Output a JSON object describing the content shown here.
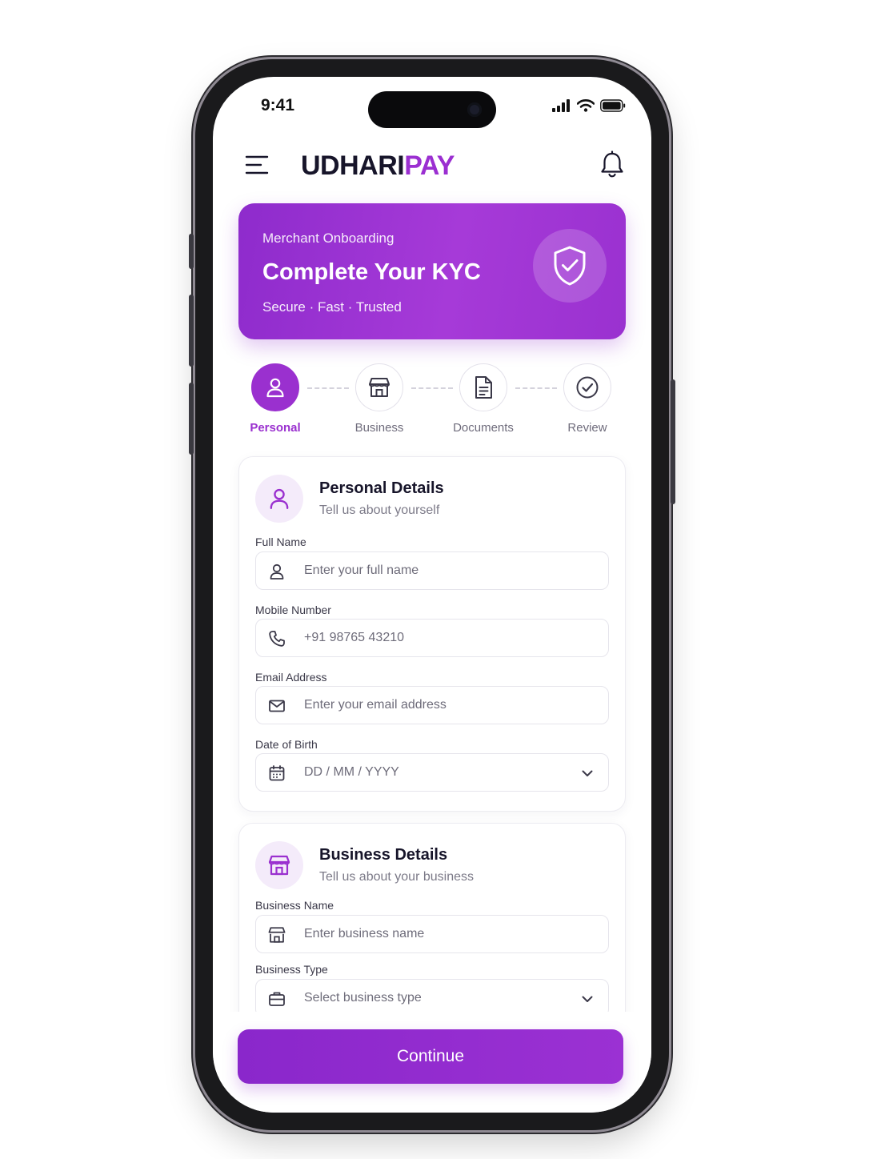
{
  "status_bar": {
    "time": "9:41"
  },
  "header": {
    "brand_part1": "UDHARI",
    "brand_part2": "PAY"
  },
  "hero": {
    "eyebrow": "Merchant Onboarding",
    "title": "Complete Your KYC",
    "subtitle": "Secure · Fast · Trusted"
  },
  "stepper": {
    "steps": [
      {
        "label": "Personal",
        "icon": "user-icon",
        "active": true
      },
      {
        "label": "Business",
        "icon": "store-icon",
        "active": false
      },
      {
        "label": "Documents",
        "icon": "document-icon",
        "active": false
      },
      {
        "label": "Review",
        "icon": "check-circle-icon",
        "active": false
      }
    ]
  },
  "personal_card": {
    "title": "Personal Details",
    "subtitle": "Tell us about yourself",
    "fields": [
      {
        "label": "Full Name",
        "placeholder": "Enter your full name",
        "icon": "user-icon"
      },
      {
        "label": "Mobile Number",
        "placeholder": "+91 98765 43210",
        "icon": "phone-icon"
      },
      {
        "label": "Email Address",
        "placeholder": "Enter your email address",
        "icon": "mail-icon"
      },
      {
        "label": "Date of Birth",
        "placeholder": "DD / MM / YYYY",
        "icon": "calendar-icon"
      }
    ]
  },
  "business_card": {
    "title": "Business Details",
    "subtitle": "Tell us about your business",
    "fields": [
      {
        "label": "Business Name",
        "placeholder": "Enter business name",
        "icon": "store-icon"
      },
      {
        "label": "Business Type",
        "placeholder": "Select business type",
        "icon": "briefcase-icon"
      }
    ]
  },
  "footer": {
    "continue_label": "Continue"
  },
  "colors": {
    "accent": "#9a30cf",
    "text_dark": "#17152a",
    "text_muted": "#7c7a88"
  }
}
